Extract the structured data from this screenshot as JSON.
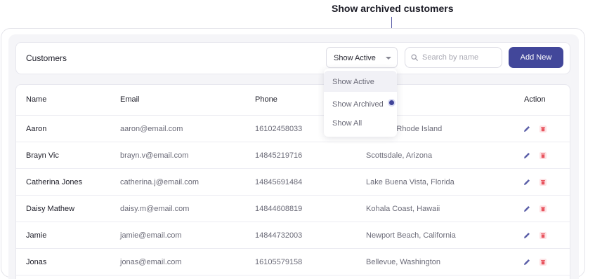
{
  "annotation": {
    "label": "Show archived customers"
  },
  "toolbar": {
    "title": "Customers",
    "filter_selected": "Show Active",
    "search_placeholder": "Search by name",
    "search_value": "",
    "add_label": "Add New"
  },
  "dropdown": {
    "options": [
      "Show Active",
      "Show Archived",
      "Show All"
    ]
  },
  "table": {
    "headers": {
      "name": "Name",
      "email": "Email",
      "phone": "Phone",
      "location": "",
      "action": "Action"
    },
    "rows": [
      {
        "name": "Aaron",
        "email": "aaron@email.com",
        "phone": "16102458033",
        "location": "...rough, Rhode Island"
      },
      {
        "name": "Brayn Vic",
        "email": "brayn.v@email.com",
        "phone": "14845219716",
        "location": "Scottsdale, Arizona"
      },
      {
        "name": "Catherina Jones",
        "email": "catherina.j@email.com",
        "phone": "14845691484",
        "location": "Lake Buena Vista, Florida"
      },
      {
        "name": "Daisy Mathew",
        "email": "daisy.m@email.com",
        "phone": "14844608819",
        "location": "Kohala Coast, Hawaii"
      },
      {
        "name": "Jamie",
        "email": "jamie@email.com",
        "phone": "14844732003",
        "location": "Newport Beach, California"
      },
      {
        "name": "Jonas",
        "email": "jonas@email.com",
        "phone": "16105579158",
        "location": "Bellevue, Washington"
      }
    ]
  },
  "colors": {
    "accent": "#42479a",
    "edit_icon": "#5b5fa8",
    "delete_icon": "#e8555f",
    "delete_icon_bg": "#fde2e4"
  },
  "icons": {
    "search": "search-icon",
    "edit": "pencil-icon",
    "delete": "trash-icon",
    "chevron": "chevron-down-icon"
  }
}
